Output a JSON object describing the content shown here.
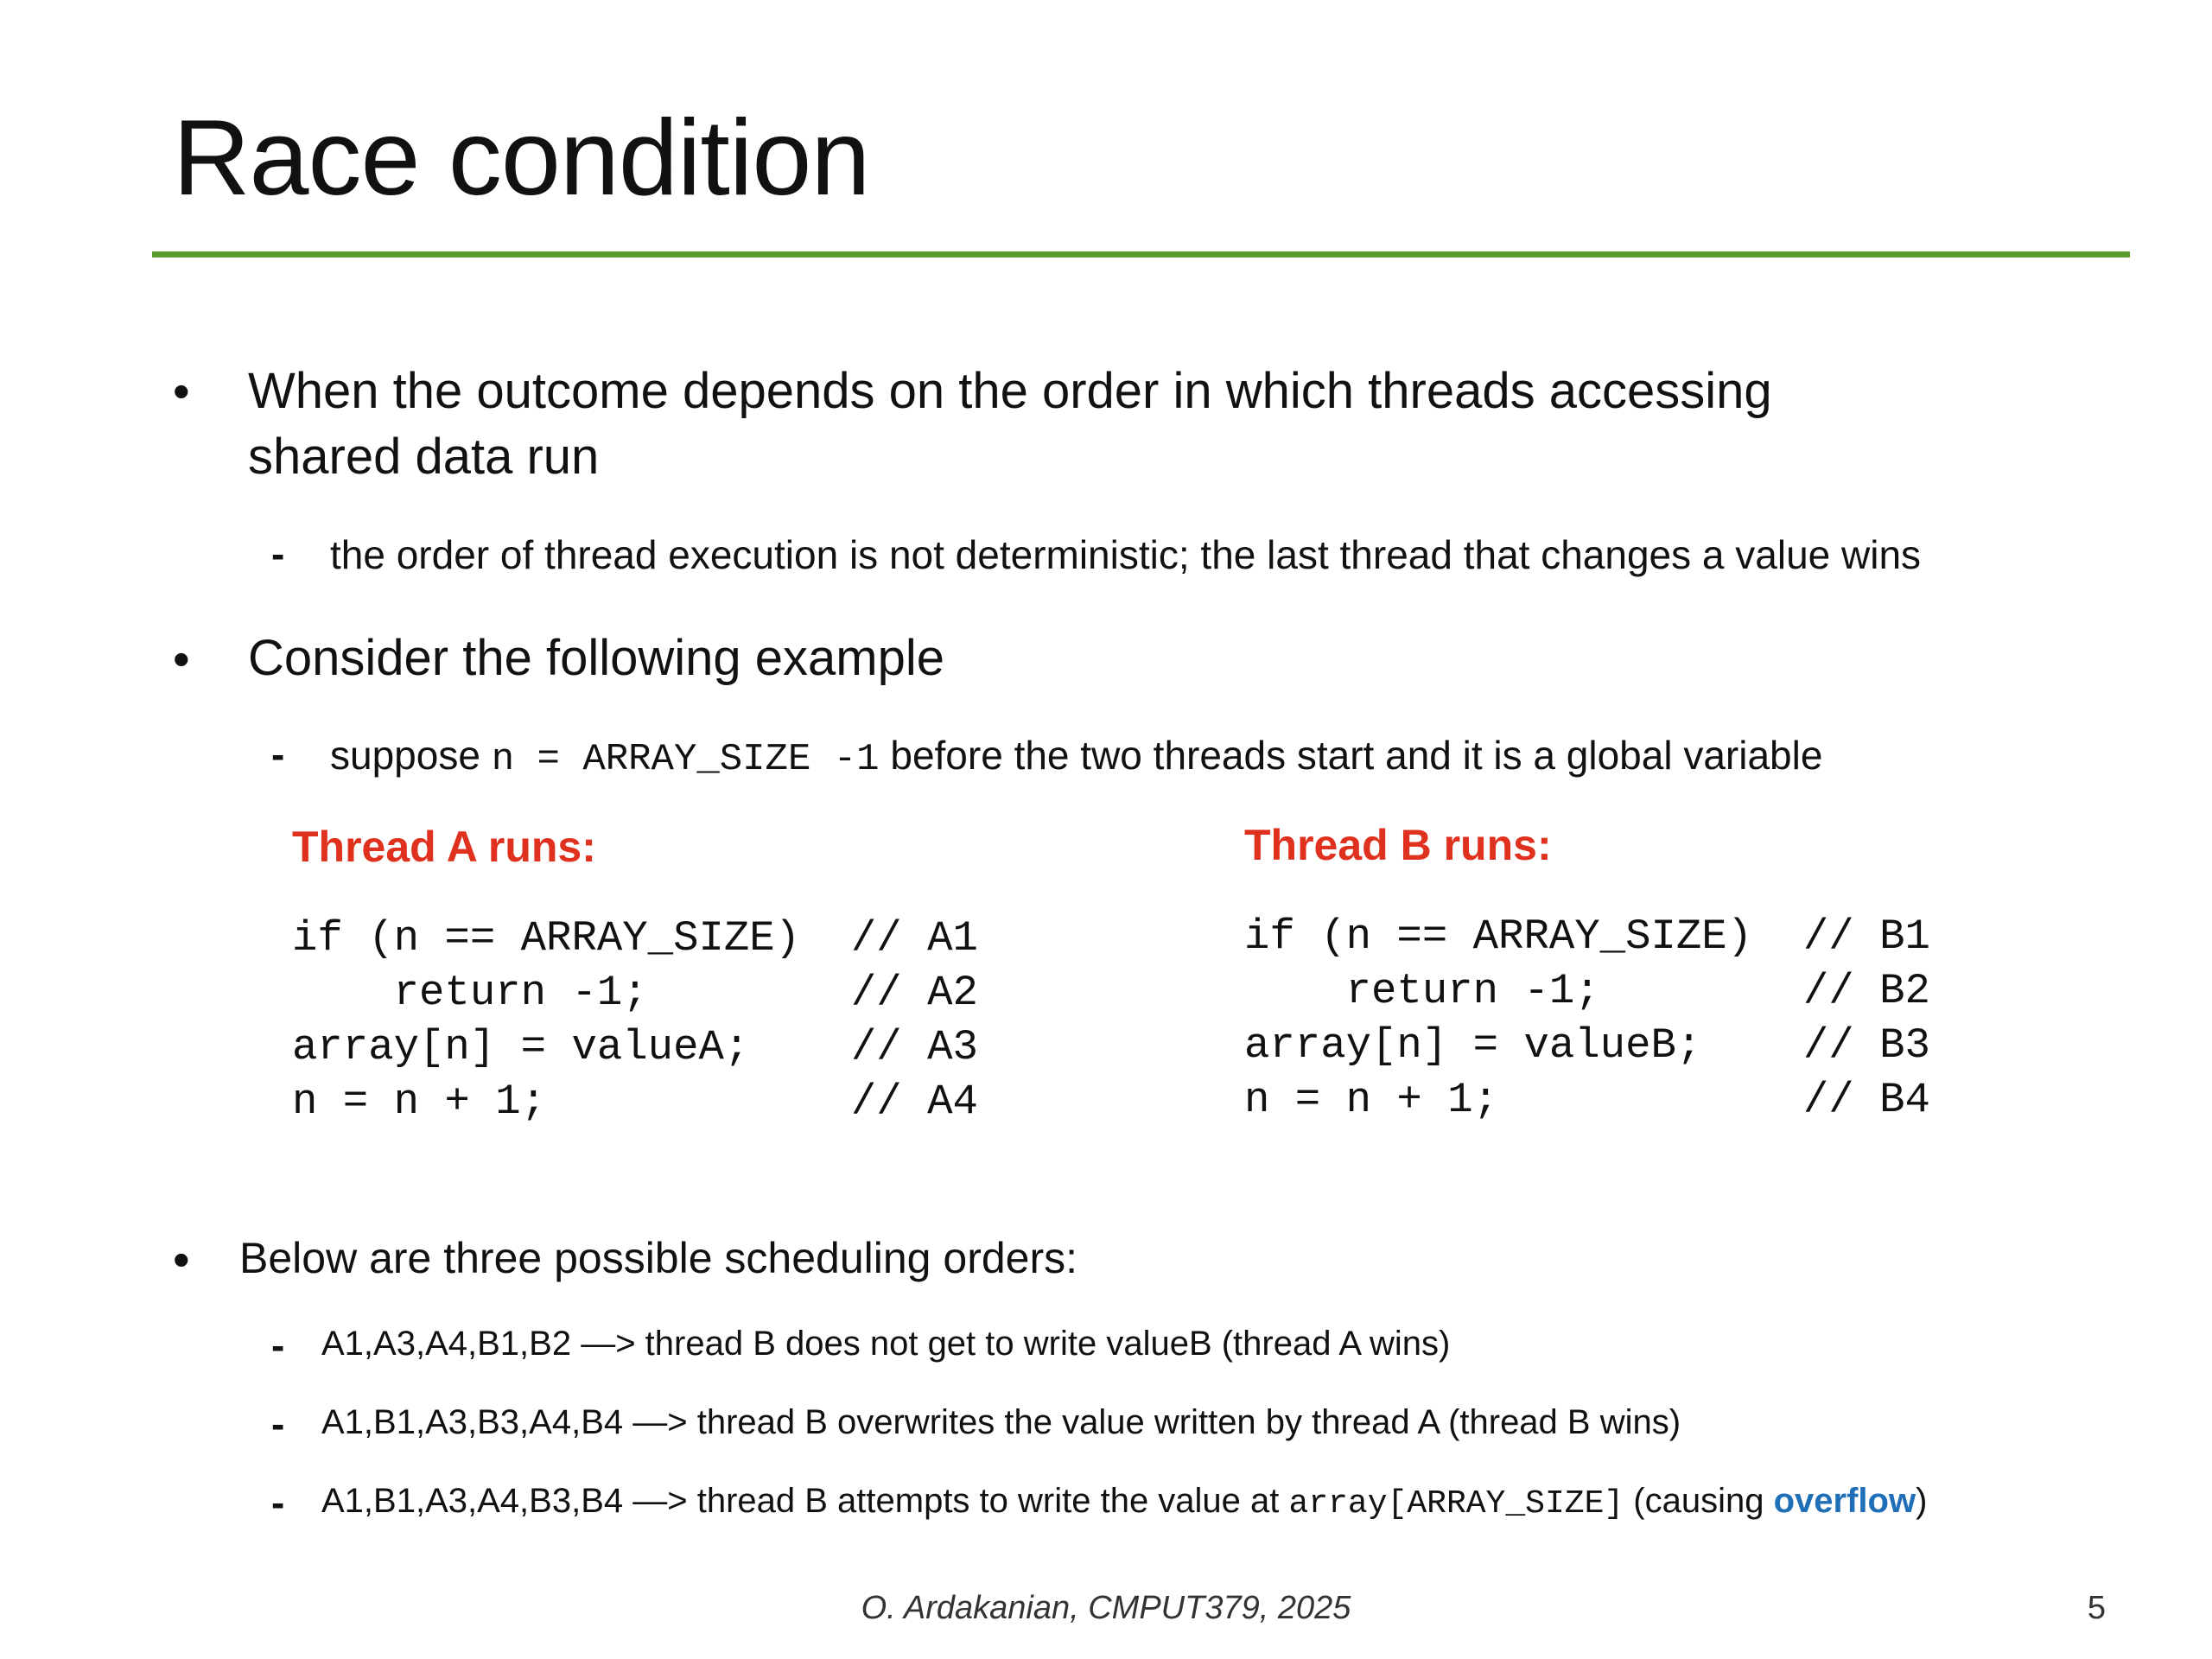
{
  "title": "Race condition",
  "colors": {
    "rule": "#5a9a2a",
    "thread_heading": "#e0301e",
    "highlight": "#1e6fb8"
  },
  "bullets": [
    {
      "lines": [
        "When the outcome depends on the order in which threads accessing",
        "shared data run"
      ],
      "sub": "the order of thread execution is not deterministic; the last thread that changes a value wins"
    },
    {
      "text": "Consider the following example",
      "sub": {
        "pre": "suppose ",
        "code": "n = ARRAY_SIZE -1",
        "post": " before the two threads start and it is a global variable"
      }
    }
  ],
  "thread_a": {
    "heading": "Thread A runs:",
    "code": "if (n == ARRAY_SIZE)  // A1\n    return -1;        // A2\narray[n] = valueA;    // A3\nn = n + 1;            // A4"
  },
  "thread_b": {
    "heading": "Thread B runs:",
    "code": "if (n == ARRAY_SIZE)  // B1\n    return -1;        // B2\narray[n] = valueB;    // B3\nn = n + 1;            // B4"
  },
  "scheduling": {
    "intro": "Below are three possible scheduling orders:",
    "orders": [
      {
        "text": "A1,A3,A4,B1,B2 —> thread B does not get to write valueB (thread A wins)"
      },
      {
        "text": "A1,B1,A3,B3,A4,B4 —> thread B overwrites the value written by thread A (thread B wins)"
      },
      {
        "pre": "A1,B1,A3,A4,B3,B4 —> thread B attempts to write the value at ",
        "code": "array[ARRAY_SIZE]",
        "mid": " (causing ",
        "highlight": "overflow",
        "post": ")"
      }
    ]
  },
  "footer": {
    "credit": "O. Ardakanian, CMPUT379, 2025",
    "page": "5"
  }
}
